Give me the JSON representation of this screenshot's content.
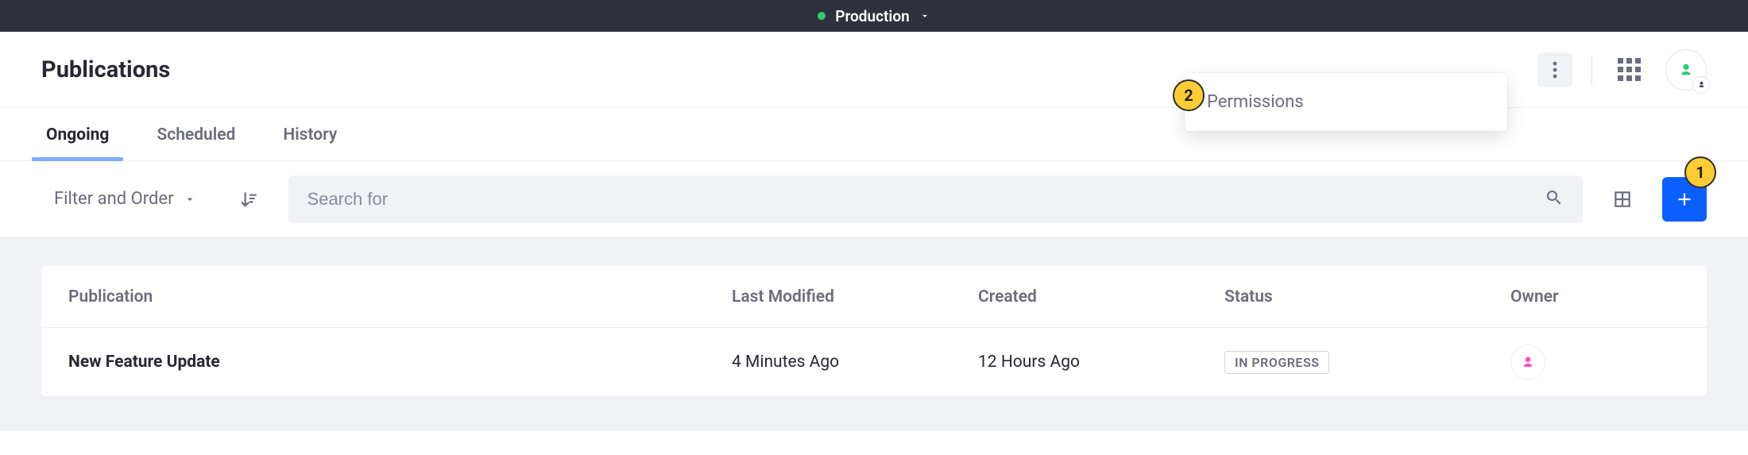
{
  "env": {
    "label": "Production"
  },
  "header": {
    "title": "Publications"
  },
  "popover": {
    "item": "Permissions"
  },
  "tabs": [
    {
      "label": "Ongoing",
      "active": true
    },
    {
      "label": "Scheduled",
      "active": false
    },
    {
      "label": "History",
      "active": false
    }
  ],
  "toolbar": {
    "filter_label": "Filter and Order",
    "search_placeholder": "Search for"
  },
  "callouts": {
    "add": "1",
    "kebab": "2"
  },
  "table": {
    "columns": {
      "publication": "Publication",
      "last_modified": "Last Modified",
      "created": "Created",
      "status": "Status",
      "owner": "Owner"
    },
    "rows": [
      {
        "name": "New Feature Update",
        "last_modified": "4 Minutes Ago",
        "created": "12 Hours Ago",
        "status": "IN PROGRESS"
      }
    ]
  },
  "colors": {
    "accent": "#0b5fff",
    "tab_underline": "#80acff",
    "callout": "#ffcc33",
    "avatar_primary": "#2ecc71",
    "owner_avatar": "#ff4fc0"
  }
}
